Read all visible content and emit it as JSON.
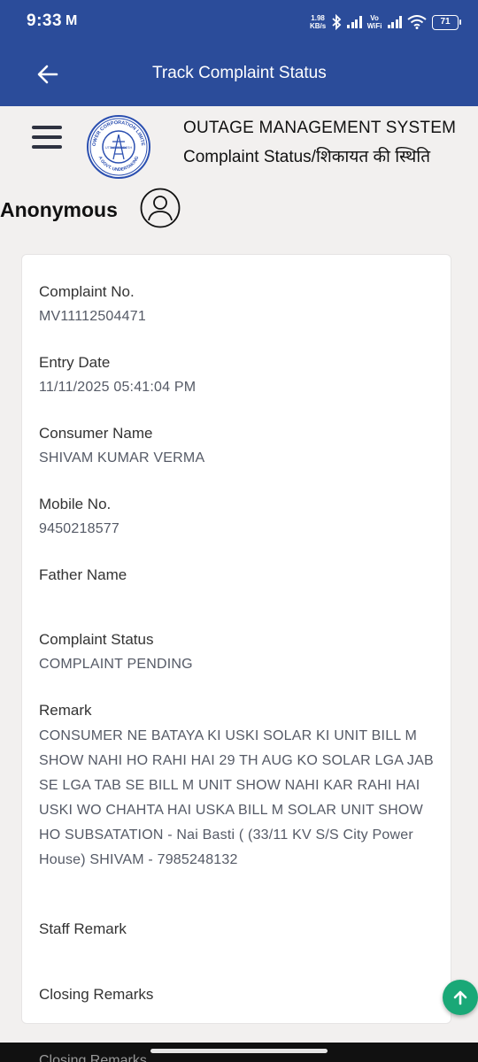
{
  "status_bar": {
    "time": "9:33",
    "mail_glyph": "M",
    "net_speed_value": "1.98",
    "net_speed_unit": "KB/s",
    "vowifi_top": "Vo",
    "vowifi_bottom": "WiFi",
    "battery": "71"
  },
  "app_bar": {
    "title": "Track Complaint Status"
  },
  "header": {
    "system_title": "OUTAGE MANAGEMENT SYSTEM",
    "subtitle": "Complaint Status/शिकायत की स्थिति",
    "user_name": "Anonymous",
    "logo_text_top": "POWER CORPORATION LIMITED",
    "logo_text_bottom": "A GOVT. UNDERTAKING",
    "logo_center": "UTTAR PRADESH"
  },
  "fields": {
    "complaint_no": {
      "label": "Complaint No.",
      "value": "MV11112504471"
    },
    "entry_date": {
      "label": "Entry Date",
      "value": "11/11/2025 05:41:04 PM"
    },
    "consumer_name": {
      "label": "Consumer Name",
      "value": "SHIVAM KUMAR VERMA"
    },
    "mobile_no": {
      "label": "Mobile No.",
      "value": "9450218577"
    },
    "father_name": {
      "label": "Father Name",
      "value": ""
    },
    "complaint_status": {
      "label": "Complaint Status",
      "value": "COMPLAINT PENDING"
    },
    "remark": {
      "label": "Remark",
      "value": "CONSUMER NE BATAYA KI USKI SOLAR KI UNIT BILL M SHOW NAHI HO RAHI HAI 29 TH AUG KO SOLAR LGA JAB SE LGA TAB SE BILL M UNIT SHOW NAHI KAR RAHI HAI USKI WO CHAHTA HAI USKA BILL M SOLAR UNIT SHOW HO SUBSATATION - Nai Basti ( (33/11 KV S/S City Power House) SHIVAM - 7985248132"
    },
    "staff_remark": {
      "label": "Staff Remark",
      "value": ""
    },
    "closing_remarks": {
      "label": "Closing Remarks",
      "value": ""
    }
  },
  "peek_text": "Closing Remarks",
  "icons": {
    "back": "arrow-left-icon",
    "menu": "hamburger-menu-icon",
    "avatar": "user-circle-icon",
    "fab": "arrow-up-icon"
  },
  "colors": {
    "primary": "#2b4c9a",
    "fab": "#1aa877",
    "background": "#f2f0ef"
  }
}
